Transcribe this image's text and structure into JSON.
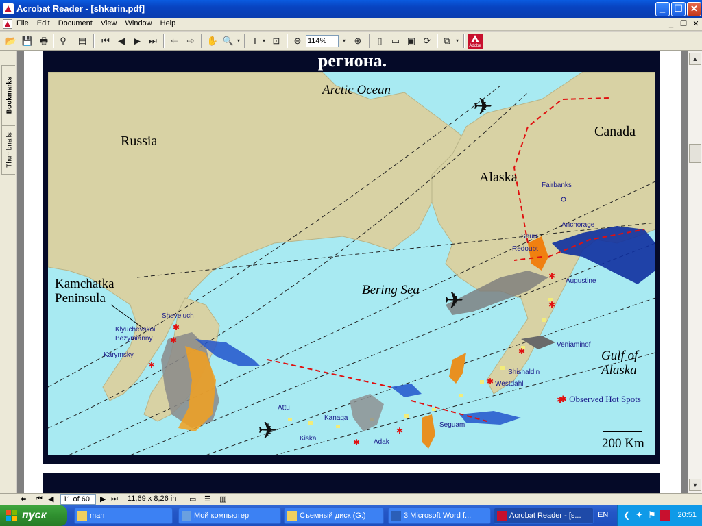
{
  "window": {
    "title": "Acrobat Reader - [shkarin.pdf]"
  },
  "menu": {
    "items": [
      "File",
      "Edit",
      "Document",
      "View",
      "Window",
      "Help"
    ]
  },
  "toolbar": {
    "zoom": "114%"
  },
  "sidebar": {
    "tabs": [
      "Bookmarks",
      "Thumbnails"
    ]
  },
  "page": {
    "heading": "региона."
  },
  "map": {
    "labels": {
      "arctic_ocean": "Arctic Ocean",
      "russia": "Russia",
      "canada": "Canada",
      "alaska": "Alaska",
      "kamchatka": "Kamchatka",
      "peninsula": "Peninsula",
      "bering_sea": "Bering Sea",
      "gulf_of": "Gulf of",
      "gulf_alaska": "Alaska",
      "scale": "200 Km",
      "legend": "Observed Hot Spots"
    },
    "places": {
      "fairbanks": "Fairbanks",
      "anchorage": "Anchorage",
      "spurr": "Spurr",
      "redoubt": "Redoubt",
      "augustine": "Augustine",
      "veniaminof": "Veniaminof",
      "shishaldin": "Shishaldin",
      "westdahl": "Westdahl",
      "sheveluch": "Sheveluch",
      "klyuchevskoi": "Klyuchevskoi",
      "bezymianny": "Bezymianny",
      "karymsky": "Karymsky",
      "attu": "Attu",
      "kanaga": "Kanaga",
      "kiska": "Kiska",
      "adak": "Adak",
      "seguam": "Seguam"
    },
    "colors": {
      "water": "#a8eaf2",
      "land": "#d8d2a4",
      "route": "#e01010"
    }
  },
  "status": {
    "page": "11 of 60",
    "size": "11,69 x 8,26 in"
  },
  "taskbar": {
    "start": "пуск",
    "tasks": [
      "man",
      "Мой компьютер",
      "Съемный диск (G:)",
      "3 Microsoft Word f...",
      "Acrobat Reader - [s..."
    ],
    "lang": "EN",
    "clock": "20:51"
  }
}
